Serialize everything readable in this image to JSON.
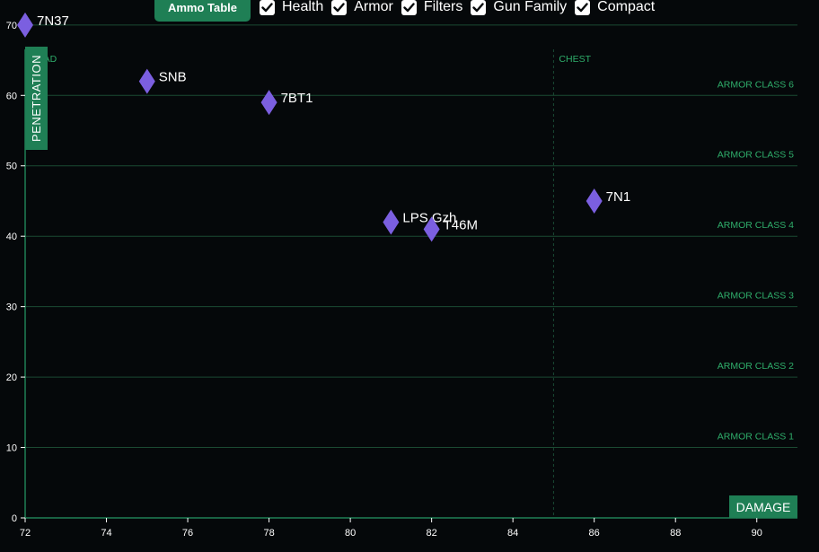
{
  "toolbar": {
    "ammo_table_label": "Ammo Table",
    "checkboxes": [
      {
        "label": "Health",
        "checked": true
      },
      {
        "label": "Armor",
        "checked": true
      },
      {
        "label": "Filters",
        "checked": true
      },
      {
        "label": "Gun Family",
        "checked": true
      },
      {
        "label": "Compact",
        "checked": true
      }
    ]
  },
  "colors": {
    "background": "#05080a",
    "accent": "#1f7f55",
    "grid": "#1b4a33",
    "reference_text": "#2fae6b",
    "point": "#7b5fe0",
    "text": "#ffffff"
  },
  "chart_data": {
    "type": "scatter",
    "xlabel": "DAMAGE",
    "ylabel": "PENETRATION",
    "xlim": [
      72,
      91
    ],
    "ylim": [
      0,
      71
    ],
    "xticks": [
      72,
      74,
      76,
      78,
      80,
      82,
      84,
      86,
      88,
      90
    ],
    "yticks": [
      0,
      10,
      20,
      30,
      40,
      50,
      60,
      70
    ],
    "points": [
      {
        "label": "7N37",
        "x": 72,
        "y": 70
      },
      {
        "label": "SNB",
        "x": 75,
        "y": 62
      },
      {
        "label": "7BT1",
        "x": 78,
        "y": 59
      },
      {
        "label": "LPS Gzh",
        "x": 81,
        "y": 42
      },
      {
        "label": "T46M",
        "x": 82,
        "y": 41
      },
      {
        "label": "7N1",
        "x": 86,
        "y": 45
      }
    ],
    "armor_classes": [
      {
        "label": "ARMOR CLASS 1",
        "y": 10
      },
      {
        "label": "ARMOR CLASS 2",
        "y": 20
      },
      {
        "label": "ARMOR CLASS 3",
        "y": 30
      },
      {
        "label": "ARMOR CLASS 4",
        "y": 40
      },
      {
        "label": "ARMOR CLASS 5",
        "y": 50
      },
      {
        "label": "ARMOR CLASS 6",
        "y": 60
      }
    ],
    "health_zones": [
      {
        "label": "HEAD",
        "x": 72
      },
      {
        "label": "CHEST",
        "x": 85
      }
    ],
    "marker": "diamond",
    "legend": "none",
    "grid": "horizontal"
  }
}
